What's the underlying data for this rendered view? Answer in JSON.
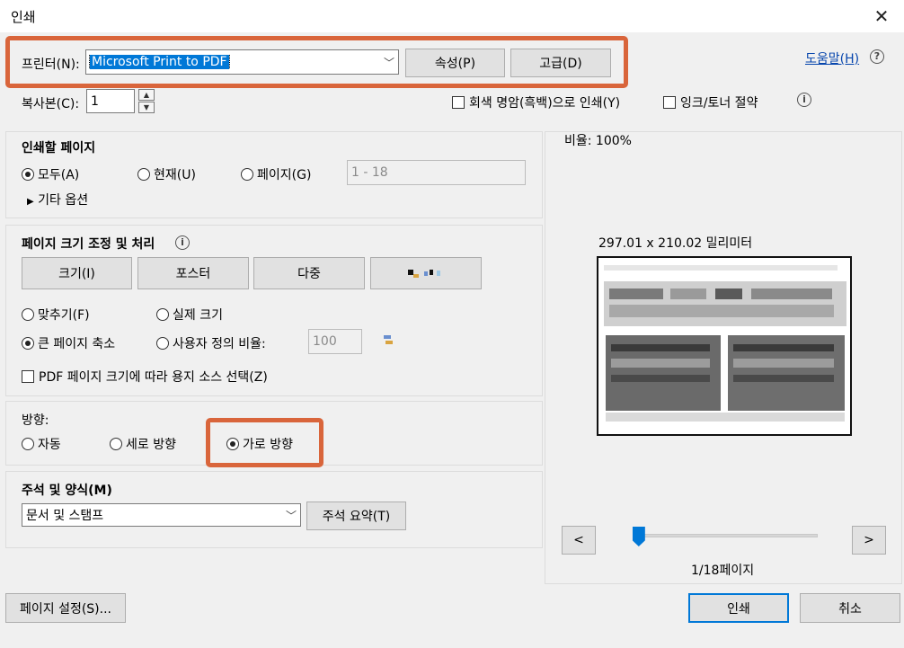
{
  "window": {
    "title": "인쇄",
    "close": "✕"
  },
  "printer": {
    "label": "프린터(N):",
    "selected": "Microsoft Print to PDF",
    "properties_button": "속성(P)",
    "advanced_button": "고급(D)",
    "help_link": "도움말(H)"
  },
  "copies": {
    "label": "복사본(C):",
    "value": "1"
  },
  "options": {
    "grayscale": "회색 명암(흑백)으로 인쇄(Y)",
    "save_ink": "잉크/토너 절약"
  },
  "pages": {
    "heading": "인쇄할 페이지",
    "all": "모두(A)",
    "current": "현재(U)",
    "pages": "페이지(G)",
    "range_placeholder": "1 - 18",
    "more": "기타 옵션"
  },
  "sizing": {
    "heading": "페이지 크기 조정 및 처리",
    "tabs": {
      "size": "크기(I)",
      "poster": "포스터",
      "multiple": "다중"
    },
    "fit": "맞추기(F)",
    "actual": "실제 크기",
    "shrink": "큰 페이지 축소",
    "custom": "사용자 정의 비율:",
    "custom_value": "100",
    "pdf_source": "PDF 페이지 크기에 따라 용지 소스 선택(Z)"
  },
  "orientation": {
    "heading": "방향:",
    "auto": "자동",
    "portrait": "세로 방향",
    "landscape": "가로 방향"
  },
  "comments": {
    "heading": "주석 및 양식(M)",
    "selected": "문서 및 스탬프",
    "summary_button": "주석 요약(T)"
  },
  "preview": {
    "scale": "비율: 100%",
    "dimensions": "297.01 x 210.02 밀리미터",
    "prev": "<",
    "next": ">",
    "page_indicator": "1/18페이지",
    "page_position": 0.02
  },
  "footer": {
    "page_setup": "페이지 설정(S)...",
    "print": "인쇄",
    "cancel": "취소"
  },
  "colors": {
    "highlight": "#d9653b",
    "accent": "#0078d7"
  }
}
